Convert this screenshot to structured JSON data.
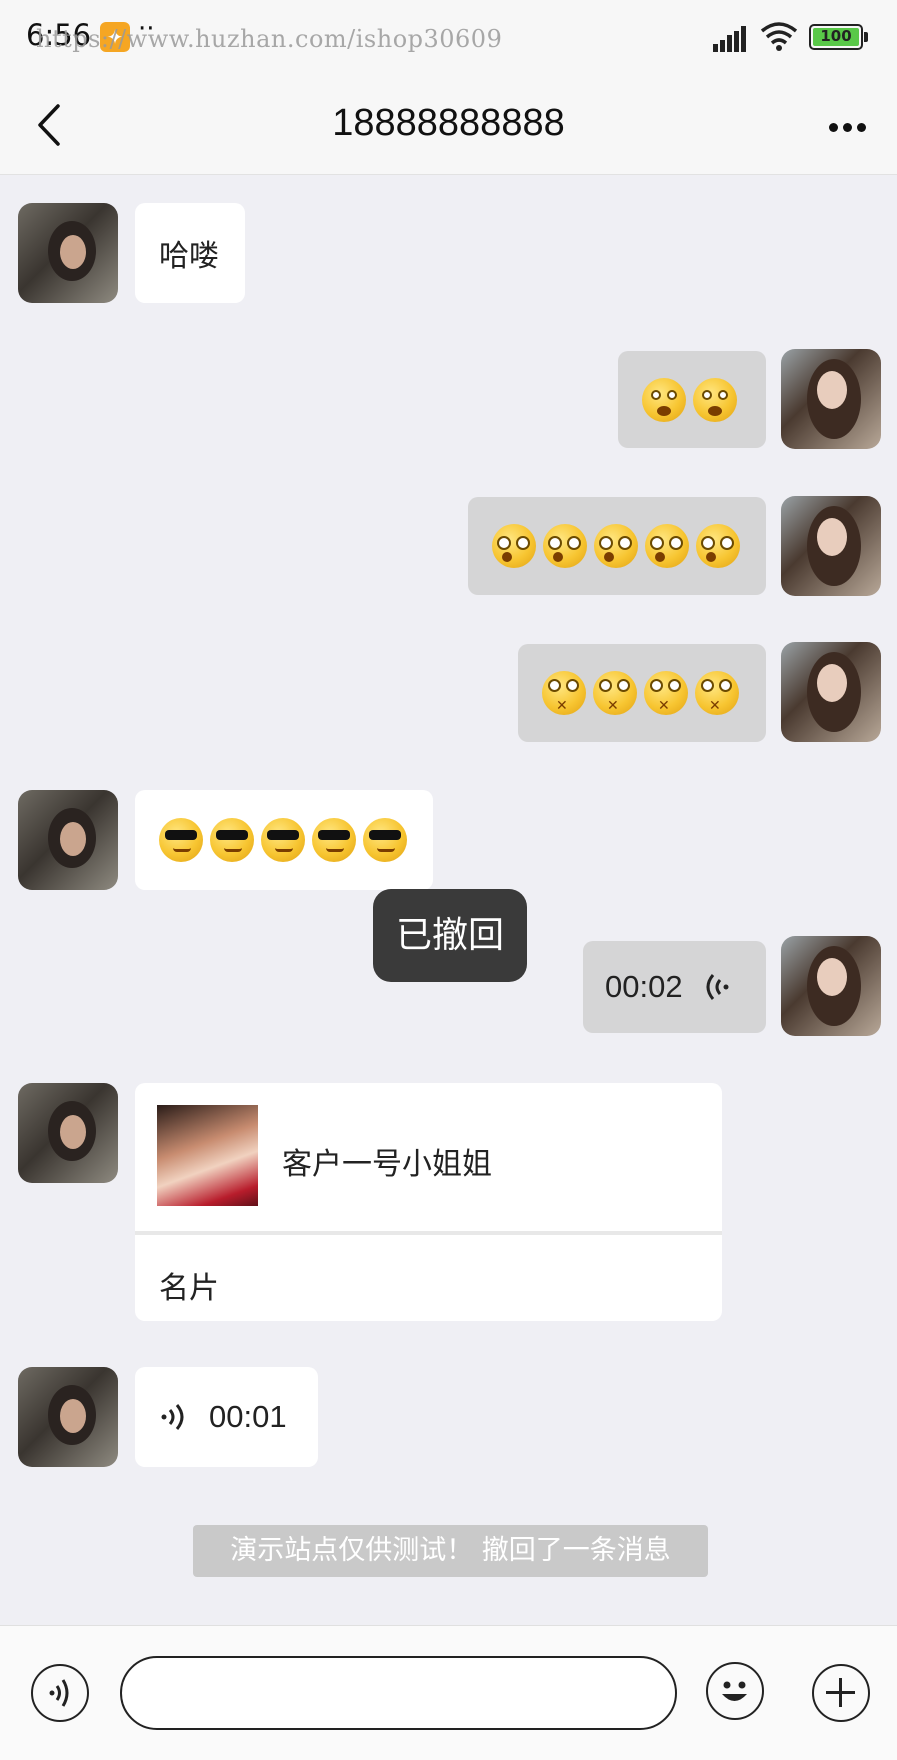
{
  "status_bar": {
    "time": "6:56",
    "extra": "··",
    "watermark": "https://www.huzhan.com/ishop30609",
    "battery": "100"
  },
  "nav": {
    "title": "18888888888"
  },
  "messages": [
    {
      "side": "left",
      "type": "text",
      "text": "哈喽"
    },
    {
      "side": "right",
      "type": "emoji",
      "count": 2,
      "emoji": "surprised"
    },
    {
      "side": "right",
      "type": "emoji",
      "count": 5,
      "emoji": "dizzy"
    },
    {
      "side": "right",
      "type": "emoji",
      "count": 4,
      "emoji": "shut-mouth"
    },
    {
      "side": "left",
      "type": "emoji",
      "count": 5,
      "emoji": "cool"
    },
    {
      "side": "right",
      "type": "voice",
      "duration": "00:02"
    },
    {
      "side": "left",
      "type": "card",
      "name": "客户一号小姐姐",
      "label": "名片"
    },
    {
      "side": "left",
      "type": "voice",
      "duration": "00:01"
    }
  ],
  "toast": "已撤回",
  "system_notice": "演示站点仅供测试！ 撤回了一条消息",
  "input": {
    "value": "",
    "placeholder": ""
  },
  "colors": {
    "background": "#efeff4",
    "bubble_left": "#ffffff",
    "bubble_right": "#d5d5d6",
    "toast": "#3a3a3a",
    "notice": "#c9c9c9"
  }
}
